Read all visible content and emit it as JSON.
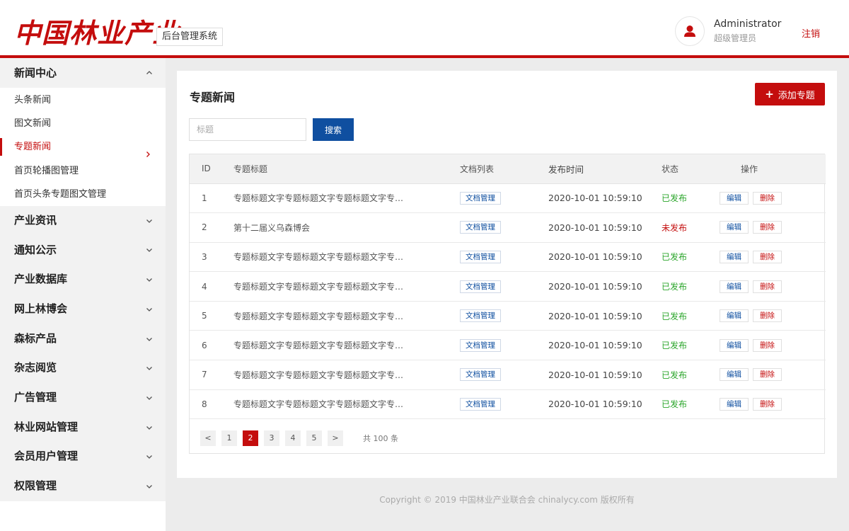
{
  "header": {
    "logo_text": "中国林业产业",
    "system_tag": "后台管理系统",
    "user_name": "Administrator",
    "user_role": "超级管理员",
    "logout_label": "注销"
  },
  "sidebar": {
    "open_group": {
      "label": "新闻中心",
      "items": [
        {
          "label": "头条新闻"
        },
        {
          "label": "图文新闻"
        },
        {
          "label": "专题新闻",
          "active": true
        },
        {
          "label": "首页轮播图管理"
        },
        {
          "label": "首页头条专题图文管理"
        }
      ]
    },
    "groups": [
      {
        "label": "产业资讯"
      },
      {
        "label": "通知公示"
      },
      {
        "label": "产业数据库"
      },
      {
        "label": "网上林博会"
      },
      {
        "label": "森标产品"
      },
      {
        "label": "杂志阅览"
      },
      {
        "label": "广告管理"
      },
      {
        "label": "林业网站管理"
      },
      {
        "label": "会员用户管理"
      },
      {
        "label": "权限管理"
      }
    ]
  },
  "main": {
    "title": "专题新闻",
    "add_label": "添加专题",
    "search": {
      "placeholder": "标题",
      "button_label": "搜索"
    },
    "table": {
      "headers": [
        "ID",
        "专题标题",
        "文档列表",
        "发布时间",
        "状态",
        "操作"
      ],
      "doc_button_label": "文档管理",
      "edit_label": "编辑",
      "delete_label": "删除",
      "rows": [
        {
          "id": "1",
          "title": "专题标题文字专题标题文字专题标题文字专题...",
          "time": "2020-10-01 10:59:10",
          "status": "已发布",
          "published": true
        },
        {
          "id": "2",
          "title": "第十二届义乌森博会",
          "time": "2020-10-01 10:59:10",
          "status": "未发布",
          "published": false
        },
        {
          "id": "3",
          "title": "专题标题文字专题标题文字专题标题文字专题...",
          "time": "2020-10-01 10:59:10",
          "status": "已发布",
          "published": true
        },
        {
          "id": "4",
          "title": "专题标题文字专题标题文字专题标题文字专题...",
          "time": "2020-10-01 10:59:10",
          "status": "已发布",
          "published": true
        },
        {
          "id": "5",
          "title": "专题标题文字专题标题文字专题标题文字专题...",
          "time": "2020-10-01 10:59:10",
          "status": "已发布",
          "published": true
        },
        {
          "id": "6",
          "title": "专题标题文字专题标题文字专题标题文字专题...",
          "time": "2020-10-01 10:59:10",
          "status": "已发布",
          "published": true
        },
        {
          "id": "7",
          "title": "专题标题文字专题标题文字专题标题文字专题...",
          "time": "2020-10-01 10:59:10",
          "status": "已发布",
          "published": true
        },
        {
          "id": "8",
          "title": "专题标题文字专题标题文字专题标题文字专题...",
          "time": "2020-10-01 10:59:10",
          "status": "已发布",
          "published": true
        }
      ]
    },
    "pagination": {
      "prev": "<",
      "next": ">",
      "pages": [
        "1",
        "2",
        "3",
        "4",
        "5"
      ],
      "current": "2",
      "total_text": "共 100 条"
    }
  },
  "footer": {
    "copyright": "Copyright © 2019 中国林业产业联合会 chinalycy.com 版权所有"
  },
  "colors": {
    "brand_red": "#c40d0d",
    "accent_blue": "#0f4fa0",
    "published_green": "#2aa52a"
  }
}
